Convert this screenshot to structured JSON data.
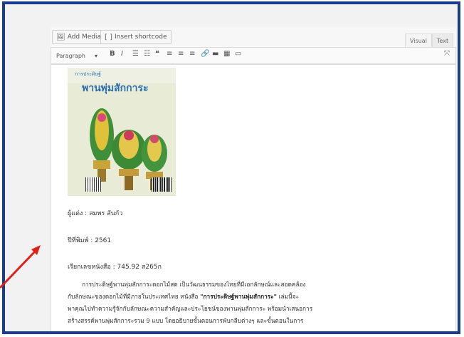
{
  "toolbar_top": {
    "add_media": "Add Media",
    "insert_shortcode": "Insert shortcode",
    "tab_visual": "Visual",
    "tab_text": "Text"
  },
  "format_toolbar": {
    "paragraph": "Paragraph"
  },
  "book": {
    "series": "การประดิษฐ์",
    "cover_title": "พานพุ่มสักการะ",
    "author_line": "ผู้แต่ง : สมพร สันกัว",
    "year_line": "ปีที่พิมพ์ : 2561",
    "call_number_line": "เรียกเลขหนังสือ : 745.92 ส265ก"
  },
  "paragraph": {
    "line1": "การประดิษฐ์พานพุ่มสักการะดอกไม้สด เป็นวัฒนธรรมของไทยที่มีเอกลักษณ์และสอดคล้อง",
    "line2_prefix": "กับลักษณะของดอกไม้ที่มีภายในประเทศไทย หนังสือ ",
    "line2_bold": "\"การประดิษฐ์พานพุ่มสักการะ\"",
    "line2_suffix": " เล่มนี้จะ",
    "line3": "พาคุณไปทำความรู้จักกับลักษณะความสำคัญและประโยชน์ของพานพุ่มสักการะ พร้อมนำเสนอการ",
    "line4": "สร้างสรรค์พานพุ่มสักการะรวม 9 แบบ โดยอธิบายขั้นตอนการพับกลีบต่างๆ และขั้นตอนในการ"
  },
  "colors": {
    "frame_border": "#1a3b8f",
    "arrow": "#e0201b"
  }
}
